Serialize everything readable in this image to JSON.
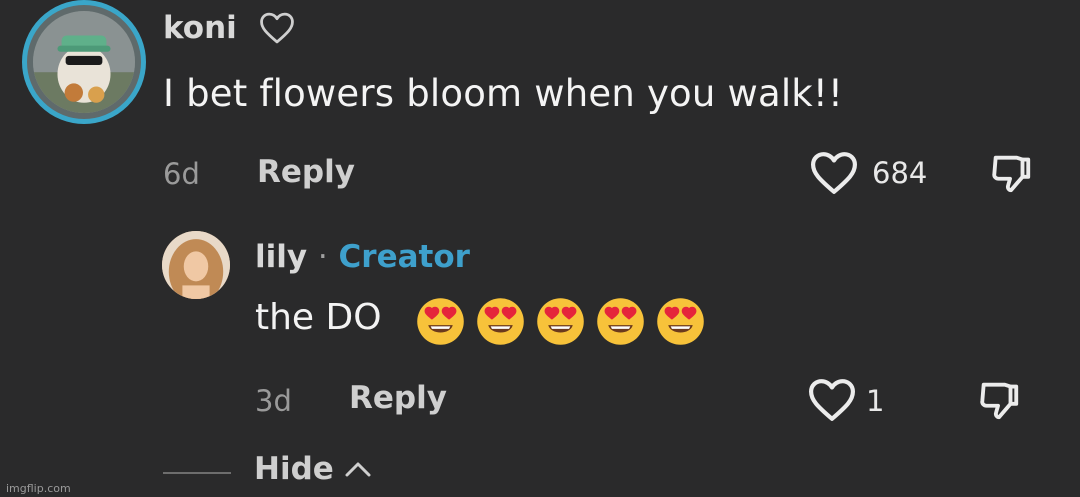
{
  "comment": {
    "username": "koni",
    "text": "I bet flowers bloom when you walk!!",
    "time": "6d",
    "reply_label": "Reply",
    "likes": "684"
  },
  "reply": {
    "username": "lily",
    "separator": "·",
    "badge": "Creator",
    "text": "the DO",
    "emoji": [
      "heart-eyes-emoji",
      "heart-eyes-emoji",
      "heart-eyes-emoji",
      "heart-eyes-emoji",
      "heart-eyes-emoji"
    ],
    "time": "3d",
    "reply_label": "Reply",
    "likes": "1"
  },
  "hide_label": "Hide",
  "watermark": "imgflip.com",
  "colors": {
    "background": "#2a2a2b",
    "avatar_ring": "#3aa6c9",
    "creator_badge": "#3ea0cc"
  }
}
